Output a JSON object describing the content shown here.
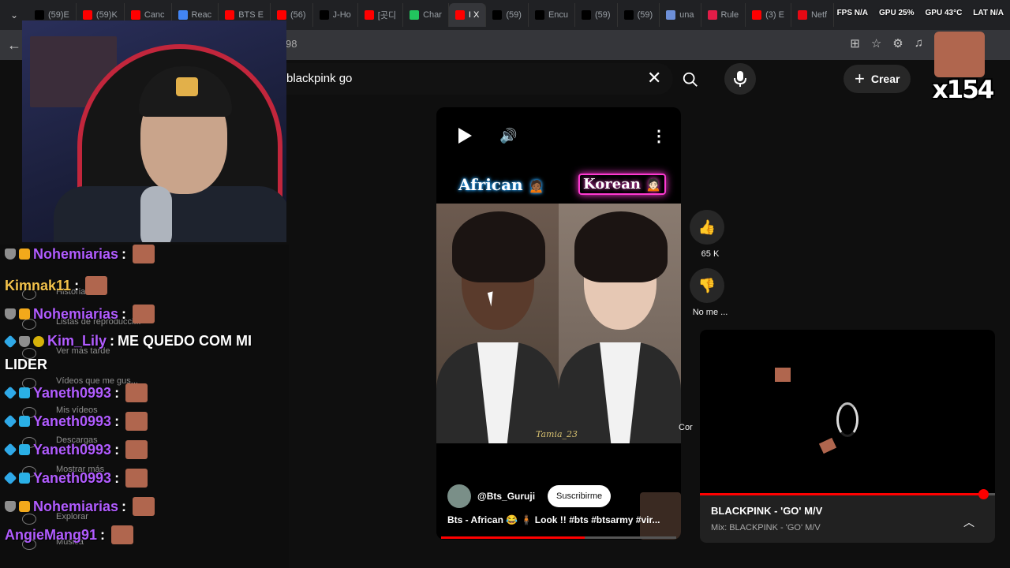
{
  "tabs": [
    {
      "title": "(59)E",
      "color": "#000000"
    },
    {
      "title": "(59)K",
      "color": "#ff0000"
    },
    {
      "title": "Canc",
      "color": "#ff0000"
    },
    {
      "title": "Reac",
      "color": "#4285f4"
    },
    {
      "title": "BTS E",
      "color": "#ff0000"
    },
    {
      "title": "(56)",
      "color": "#ff0000"
    },
    {
      "title": "J-Ho",
      "color": "#000000"
    },
    {
      "title": "[곳디",
      "color": "#ff0000"
    },
    {
      "title": "Char",
      "color": "#22c55e"
    },
    {
      "title": "I X",
      "color": "#ff0000"
    },
    {
      "title": "(59)",
      "color": "#000000"
    },
    {
      "title": "Encu",
      "color": "#000000"
    },
    {
      "title": "(59)",
      "color": "#000000"
    },
    {
      "title": "(59)",
      "color": "#000000"
    },
    {
      "title": "una",
      "color": "#6d8fd8"
    },
    {
      "title": "Rule",
      "color": "#e11d48"
    },
    {
      "title": "(3) E",
      "color": "#ff0000"
    },
    {
      "title": "Netf",
      "color": "#e50914"
    }
  ],
  "stats": {
    "fps": "FPS N/A",
    "gpu": "GPU 25%",
    "gpu_temp": "GPU 43°C",
    "lat": "LAT N/A"
  },
  "address": {
    "url_fragment": "98"
  },
  "search": {
    "query": "blackpink go",
    "create_label": "Crear"
  },
  "overlay": {
    "emote_count": "x154"
  },
  "sidebar_ghost": [
    "Historial",
    "Listas de reproducci...",
    "Ver más tarde",
    "Vídeos que me gus...",
    "Mis vídeos",
    "Descargas",
    "Mostrar más",
    "Explorar",
    "Música"
  ],
  "chat": [
    {
      "user": "Nohemiarias",
      "color": "#b15cff",
      "badges": [
        "shield",
        "crown"
      ],
      "text": "",
      "emote": true
    },
    {
      "user": "Kimnak11",
      "color": "#f2c24b",
      "badges": [],
      "text": "",
      "emote": true
    },
    {
      "user": "Nohemiarias",
      "color": "#b15cff",
      "badges": [
        "shield",
        "crown"
      ],
      "text": "",
      "emote": true
    },
    {
      "user": "Kim_Lily",
      "color": "#b15cff",
      "badges": [
        "gem",
        "shield",
        "bits"
      ],
      "text": "ME QUEDO COM MI",
      "text2": "LIDER",
      "emote": false
    },
    {
      "user": "Yaneth0993",
      "color": "#b15cff",
      "badges": [
        "gem",
        "sub"
      ],
      "text": "",
      "emote": true
    },
    {
      "user": "Yaneth0993",
      "color": "#b15cff",
      "badges": [
        "gem",
        "sub"
      ],
      "text": "",
      "emote": true
    },
    {
      "user": "Yaneth0993",
      "color": "#b15cff",
      "badges": [
        "gem",
        "sub"
      ],
      "text": "",
      "emote": true
    },
    {
      "user": "Yaneth0993",
      "color": "#b15cff",
      "badges": [
        "gem",
        "sub"
      ],
      "text": "",
      "emote": true
    },
    {
      "user": "Nohemiarias",
      "color": "#b15cff",
      "badges": [
        "shield",
        "crown"
      ],
      "text": "",
      "emote": true
    },
    {
      "user": "AngieMang91",
      "color": "#b15cff",
      "badges": [],
      "text": "",
      "emote": true
    }
  ],
  "short": {
    "label_left": "African",
    "label_right": "Korean",
    "watermark": "Tamia_23",
    "channel": "@Bts_Guruji",
    "subscribe_label": "Suscribirme",
    "title": "Bts - African 😂 🧍🏾 Look !! #bts #btsarmy #vir...",
    "progress": 0.61
  },
  "actions": {
    "likes": "65 K",
    "dislike_label": "No me ...",
    "comments_label": "Cor"
  },
  "miniplayer": {
    "title": "BLACKPINK - 'GO' M/V",
    "subtitle": "Mix: BLACKPINK - 'GO' M/V",
    "progress": 0.96
  }
}
